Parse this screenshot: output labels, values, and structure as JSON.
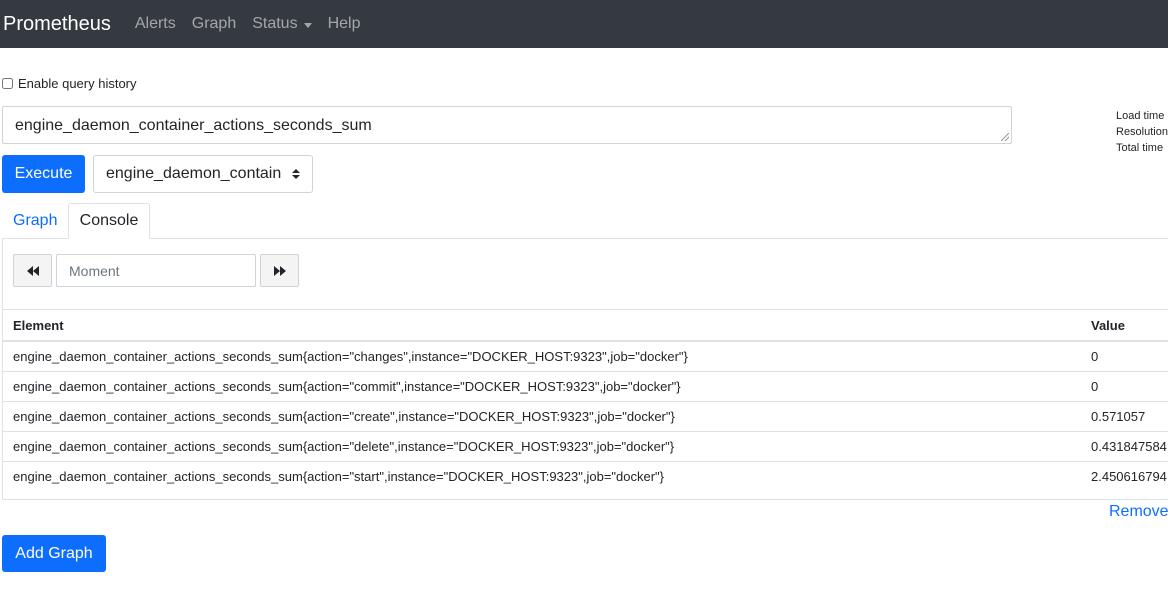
{
  "navbar": {
    "brand": "Prometheus",
    "links": [
      "Alerts",
      "Graph",
      "Status",
      "Help"
    ]
  },
  "history": {
    "label": "Enable query history",
    "checked": false
  },
  "query": {
    "expression": "engine_daemon_container_actions_seconds_sum",
    "execute_label": "Execute",
    "metric_select_value": "engine_daemon_contain"
  },
  "stats": {
    "load_time": "Load time",
    "resolution": "Resolution",
    "total_time": "Total time"
  },
  "tabs": {
    "graph": "Graph",
    "console": "Console"
  },
  "console": {
    "moment_placeholder": "Moment"
  },
  "table": {
    "columns": [
      "Element",
      "Value"
    ],
    "rows": [
      {
        "element": "engine_daemon_container_actions_seconds_sum{action=\"changes\",instance=\"DOCKER_HOST:9323\",job=\"docker\"}",
        "value": "0"
      },
      {
        "element": "engine_daemon_container_actions_seconds_sum{action=\"commit\",instance=\"DOCKER_HOST:9323\",job=\"docker\"}",
        "value": "0"
      },
      {
        "element": "engine_daemon_container_actions_seconds_sum{action=\"create\",instance=\"DOCKER_HOST:9323\",job=\"docker\"}",
        "value": "0.571057"
      },
      {
        "element": "engine_daemon_container_actions_seconds_sum{action=\"delete\",instance=\"DOCKER_HOST:9323\",job=\"docker\"}",
        "value": "0.431847584"
      },
      {
        "element": "engine_daemon_container_actions_seconds_sum{action=\"start\",instance=\"DOCKER_HOST:9323\",job=\"docker\"}",
        "value": "2.450616794"
      }
    ]
  },
  "actions": {
    "remove": "Remove",
    "add_graph": "Add Graph"
  },
  "colors": {
    "navbar": "#343a40",
    "primary": "#0d6efd"
  }
}
